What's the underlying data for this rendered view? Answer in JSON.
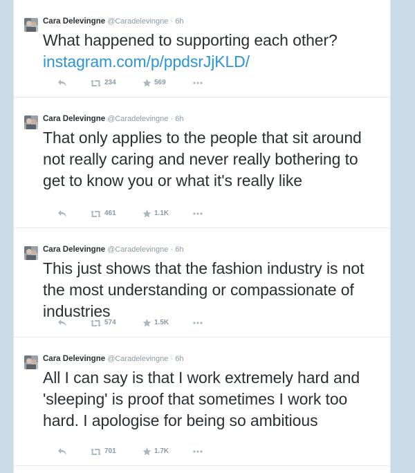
{
  "colors": {
    "page_background": "#c9dbe8",
    "card_background": "#ffffff",
    "divider": "#e1e8ed",
    "text": "#292f33",
    "muted": "#8899a6",
    "link": "#2a94d6",
    "action_icon": "#aab8c2"
  },
  "icons": {
    "reply": "reply-arrow-icon",
    "retweet": "retweet-arrows-icon",
    "favorite": "star-icon",
    "more": "ellipsis-icon",
    "avatar": "profile-photo"
  },
  "tweets": [
    {
      "fullname": "Cara Delevingne",
      "username": "@Caradelevingne",
      "separator": "·",
      "time": "6h",
      "text": "What happened to supporting each other?",
      "link": "instagram.com/p/ppdsrJjKLD/",
      "retweets": "234",
      "favorites": "569"
    },
    {
      "fullname": "Cara Delevingne",
      "username": "@Caradelevingne",
      "separator": "·",
      "time": "6h",
      "text": "That only applies to the people that sit around not really caring and never really bothering to get to know you or what it's really like",
      "retweets": "461",
      "favorites": "1.1K"
    },
    {
      "fullname": "Cara Delevingne",
      "username": "@Caradelevingne",
      "separator": "·",
      "time": "6h",
      "text": "This just shows that the fashion industry is not the most understanding or compassionate of industries",
      "retweets": "574",
      "favorites": "1.5K"
    },
    {
      "fullname": "Cara Delevingne",
      "username": "@Caradelevingne",
      "separator": "·",
      "time": "6h",
      "text": "All I can say is that I work extremely hard and 'sleeping' is proof that sometimes I work too hard. I apologise for being so ambitious",
      "retweets": "701",
      "favorites": "1.7K"
    }
  ]
}
